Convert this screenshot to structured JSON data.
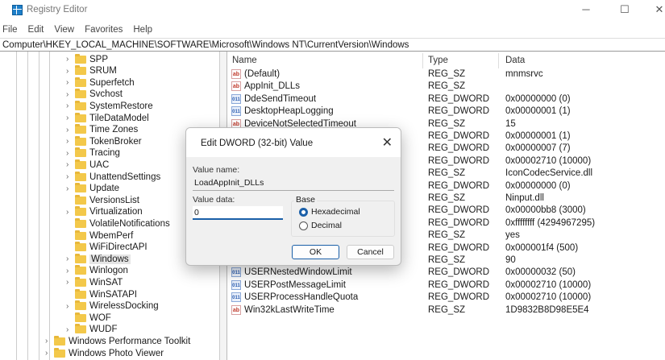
{
  "window": {
    "title": "Registry Editor",
    "minimize": "─",
    "maximize": "☐",
    "close": "✕"
  },
  "menu": [
    "File",
    "Edit",
    "View",
    "Favorites",
    "Help"
  ],
  "address": "Computer\\HKEY_LOCAL_MACHINE\\SOFTWARE\\Microsoft\\Windows NT\\CurrentVersion\\Windows",
  "tree": {
    "children": [
      {
        "label": "SPP",
        "expandable": true
      },
      {
        "label": "SRUM",
        "expandable": true
      },
      {
        "label": "Superfetch",
        "expandable": true
      },
      {
        "label": "Svchost",
        "expandable": true
      },
      {
        "label": "SystemRestore",
        "expandable": true
      },
      {
        "label": "TileDataModel",
        "expandable": true
      },
      {
        "label": "Time Zones",
        "expandable": true
      },
      {
        "label": "TokenBroker",
        "expandable": true
      },
      {
        "label": "Tracing",
        "expandable": true
      },
      {
        "label": "UAC",
        "expandable": true
      },
      {
        "label": "UnattendSettings",
        "expandable": true
      },
      {
        "label": "Update",
        "expandable": true
      },
      {
        "label": "VersionsList",
        "expandable": false
      },
      {
        "label": "Virtualization",
        "expandable": true
      },
      {
        "label": "VolatileNotifications",
        "expandable": false
      },
      {
        "label": "WbemPerf",
        "expandable": false
      },
      {
        "label": "WiFiDirectAPI",
        "expandable": false
      },
      {
        "label": "Windows",
        "expandable": true,
        "selected": true
      },
      {
        "label": "Winlogon",
        "expandable": true
      },
      {
        "label": "WinSAT",
        "expandable": true
      },
      {
        "label": "WinSATAPI",
        "expandable": false
      },
      {
        "label": "WirelessDocking",
        "expandable": true
      },
      {
        "label": "WOF",
        "expandable": false
      },
      {
        "label": "WUDF",
        "expandable": true
      }
    ],
    "siblings": [
      {
        "label": "Windows Performance Toolkit"
      },
      {
        "label": "Windows Photo Viewer"
      }
    ]
  },
  "list": {
    "headers": {
      "name": "Name",
      "type": "Type",
      "data": "Data"
    },
    "rows": [
      {
        "name": "(Default)",
        "type": "REG_SZ",
        "data": "mnmsrvc",
        "icon": "sz"
      },
      {
        "name": "AppInit_DLLs",
        "type": "REG_SZ",
        "data": "",
        "icon": "sz"
      },
      {
        "name": "DdeSendTimeout",
        "type": "REG_DWORD",
        "data": "0x00000000 (0)",
        "icon": "dw"
      },
      {
        "name": "DesktopHeapLogging",
        "type": "REG_DWORD",
        "data": "0x00000001 (1)",
        "icon": "dw"
      },
      {
        "name": "DeviceNotSelectedTimeout",
        "type": "REG_SZ",
        "data": "15",
        "icon": "sz"
      },
      {
        "name": "",
        "type": "REG_DWORD",
        "data": "0x00000001 (1)",
        "icon": ""
      },
      {
        "name": "",
        "type": "REG_DWORD",
        "data": "0x00000007 (7)",
        "icon": ""
      },
      {
        "name": "",
        "type": "REG_DWORD",
        "data": "0x00002710 (10000)",
        "icon": ""
      },
      {
        "name": "",
        "type": "REG_SZ",
        "data": "IconCodecService.dll",
        "icon": ""
      },
      {
        "name": "",
        "type": "REG_DWORD",
        "data": "0x00000000 (0)",
        "icon": ""
      },
      {
        "name": "",
        "type": "REG_SZ",
        "data": "Ninput.dll",
        "icon": ""
      },
      {
        "name": "",
        "type": "REG_DWORD",
        "data": "0x00000bb8 (3000)",
        "icon": ""
      },
      {
        "name": "",
        "type": "REG_DWORD",
        "data": "0xffffffff (4294967295)",
        "icon": ""
      },
      {
        "name": "",
        "type": "REG_SZ",
        "data": "yes",
        "icon": ""
      },
      {
        "name": "",
        "type": "REG_DWORD",
        "data": "0x000001f4 (500)",
        "icon": ""
      },
      {
        "name": "",
        "type": "REG_SZ",
        "data": "90",
        "icon": ""
      },
      {
        "name": "USERNestedWindowLimit",
        "type": "REG_DWORD",
        "data": "0x00000032 (50)",
        "icon": "dw"
      },
      {
        "name": "USERPostMessageLimit",
        "type": "REG_DWORD",
        "data": "0x00002710 (10000)",
        "icon": "dw"
      },
      {
        "name": "USERProcessHandleQuota",
        "type": "REG_DWORD",
        "data": "0x00002710 (10000)",
        "icon": "dw"
      },
      {
        "name": "Win32kLastWriteTime",
        "type": "REG_SZ",
        "data": "1D9832B8D98E5E4",
        "icon": "sz"
      }
    ]
  },
  "dialog": {
    "title": "Edit DWORD (32-bit) Value",
    "close": "✕",
    "value_name_label": "Value name:",
    "value_name": "LoadAppInit_DLLs",
    "value_data_label": "Value data:",
    "value_data": "0",
    "base_label": "Base",
    "hex_label": "Hexadecimal",
    "dec_label": "Decimal",
    "base_selected": "Hexadecimal",
    "ok": "OK",
    "cancel": "Cancel"
  },
  "colors": {
    "accent": "#1a5fa8",
    "folder": "#f3c84a"
  }
}
